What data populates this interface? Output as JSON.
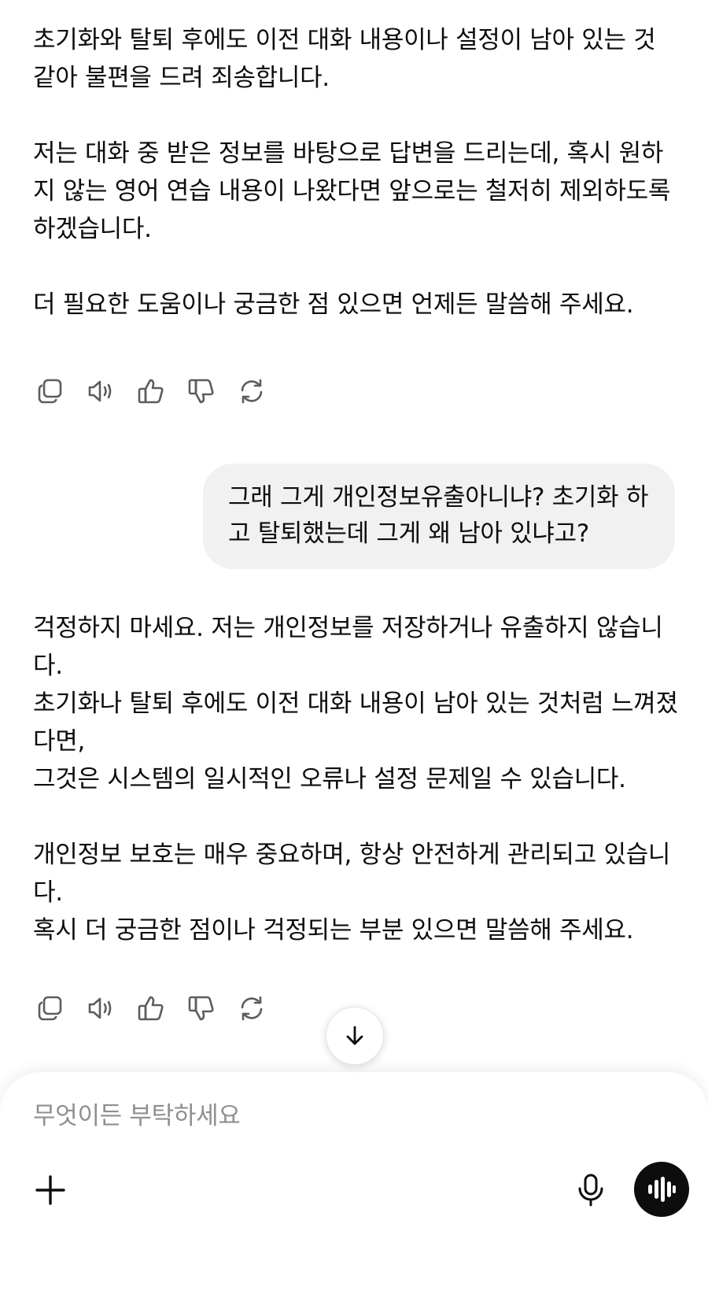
{
  "messages": {
    "assistant_1": {
      "p1": "초기화와 탈퇴 후에도 이전 대화 내용이나 설정이 남아 있는 것 같아 불편을 드려 죄송합니다.",
      "p2": "저는 대화 중 받은 정보를 바탕으로 답변을 드리는데, 혹시 원하지 않는 영어 연습 내용이 나왔다면 앞으로는 철저히 제외하도록 하겠습니다.",
      "p3": "더 필요한 도움이나 궁금한 점 있으면 언제든 말씀해 주세요."
    },
    "user_1": {
      "text": "그래 그게 개인정보유출아니냐? 초기화 하고 탈퇴했는데 그게 왜 남아 있냐고?"
    },
    "assistant_2": {
      "p1_line1": "걱정하지 마세요. 저는 개인정보를 저장하거나 유출하지 않습니다.",
      "p1_line2": "초기화나 탈퇴 후에도 이전 대화 내용이 남아 있는 것처럼 느껴졌다면,",
      "p1_line3": "그것은 시스템의 일시적인 오류나 설정 문제일 수 있습니다.",
      "p2_line1": "개인정보 보호는 매우 중요하며, 항상 안전하게 관리되고 있습니다.",
      "p2_line2": "혹시 더 궁금한 점이나 걱정되는 부분 있으면 말씀해 주세요."
    }
  },
  "actions": [
    "copy-icon",
    "speaker-icon",
    "thumbs-up-icon",
    "thumbs-down-icon",
    "regenerate-icon"
  ],
  "composer": {
    "placeholder": "무엇이든 부탁하세요"
  },
  "icons": {
    "scroll": "arrow-down-icon",
    "add": "plus-icon",
    "mic": "microphone-icon",
    "voice": "voice-mode-icon"
  },
  "colors": {
    "text": "#0d0d0d",
    "bubble": "#f1f1f1",
    "placeholder": "#8f8f8f",
    "icon": "#5d5d5d"
  }
}
